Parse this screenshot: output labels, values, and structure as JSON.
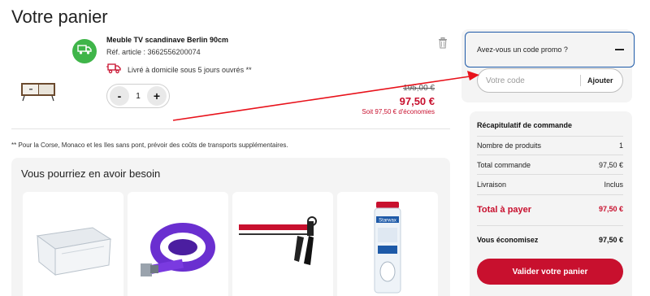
{
  "page": {
    "title": "Votre panier"
  },
  "cart_item": {
    "name": "Meuble TV scandinave Berlin 90cm",
    "reference": "Réf. article : 3662556200074",
    "delivery": "Livré à domicile sous 5 jours ouvrés **",
    "quantity": "1",
    "qty_minus": "-",
    "qty_plus": "+",
    "price_old": "195,00 €",
    "price_new": "97,50 €",
    "savings": "Soit 97,50 € d'économies",
    "icons": [
      "tv-cabinet-image",
      "delivery-truck-icon",
      "trash-icon"
    ]
  },
  "footnote": "** Pour la Corse, Monaco et les Iles sans pont, prévoir des coûts de transports supplémentaires.",
  "suggestions": {
    "title": "Vous pourriez en avoir besoin",
    "products": [
      "storage-box-image",
      "ratchet-strap-image",
      "caulking-gun-image",
      "drain-cleaner-image"
    ],
    "bottle_brand": "Starwax"
  },
  "promo": {
    "toggle_label": "Avez-vous un code promo ?",
    "placeholder": "Votre code",
    "apply_label": "Ajouter"
  },
  "summary": {
    "title": "Récapitulatif de commande",
    "rows": [
      {
        "label": "Nombre de produits",
        "value": "1"
      },
      {
        "label": "Total commande",
        "value": "97,50 €"
      },
      {
        "label": "Livraison",
        "value": "Inclus"
      }
    ],
    "total_label": "Total à payer",
    "total_value": "97,50 €",
    "savings_label": "Vous économisez",
    "savings_value": "97,50 €",
    "validate_label": "Valider votre panier"
  },
  "colors": {
    "accent_red": "#c8102e",
    "badge_green": "#3fb549",
    "focus_blue": "#1e5aa8",
    "panel_grey": "#f4f4f4",
    "arrow_red": "#e8121b"
  }
}
